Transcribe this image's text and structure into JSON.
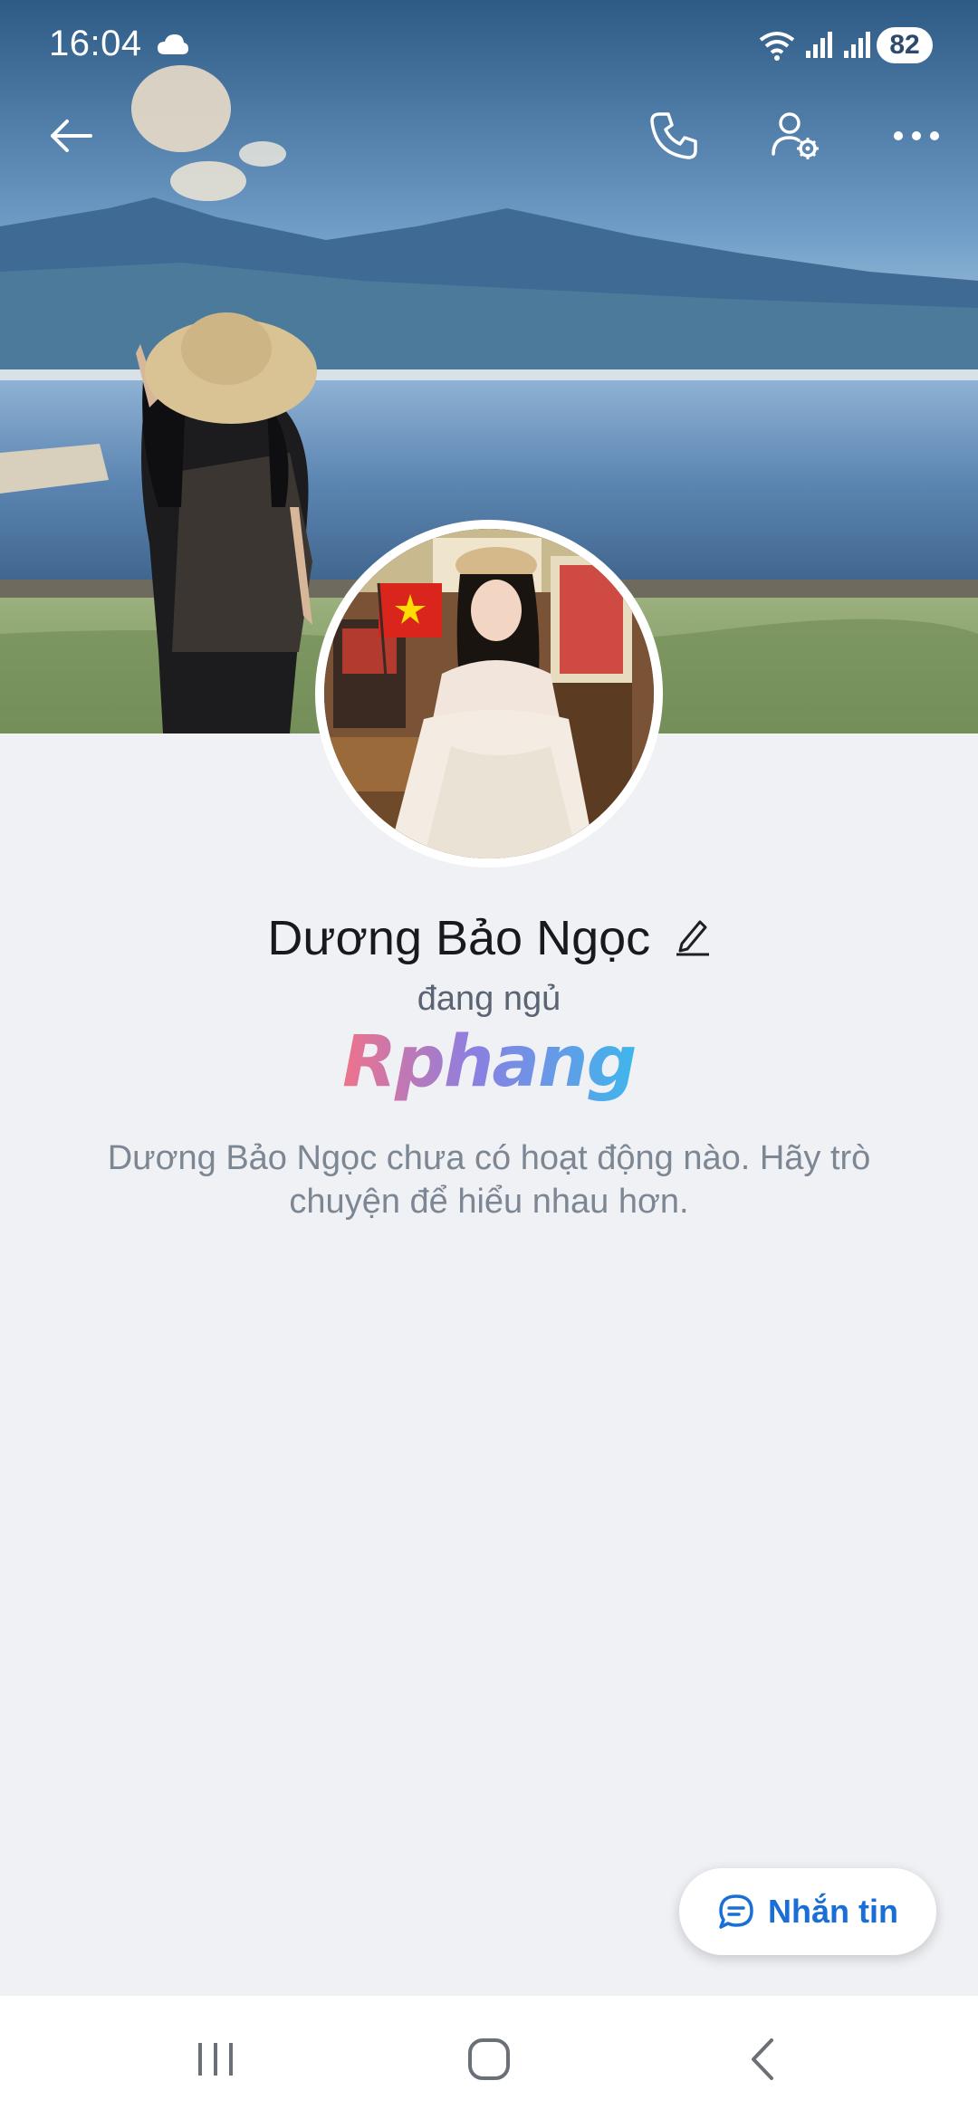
{
  "status_bar": {
    "time": "16:04",
    "battery": "82"
  },
  "profile": {
    "name": "Dương Bảo Ngọc",
    "status": "đang ngủ",
    "empty_message": "Dương Bảo Ngọc chưa có hoạt động nào. Hãy trò chuyện để hiểu nhau hơn."
  },
  "watermark": "Rphang",
  "actions": {
    "message_label": "Nhắn tin"
  },
  "icons": {
    "back": "arrow-left-icon",
    "call": "phone-icon",
    "profile_settings": "user-gear-icon",
    "more": "more-dots-icon",
    "edit": "pencil-icon",
    "message": "chat-bubble-icon"
  },
  "colors": {
    "accent": "#1a6fd6",
    "background": "#eff1f5",
    "name_text": "#161a1f",
    "secondary_text": "#7d8794"
  }
}
